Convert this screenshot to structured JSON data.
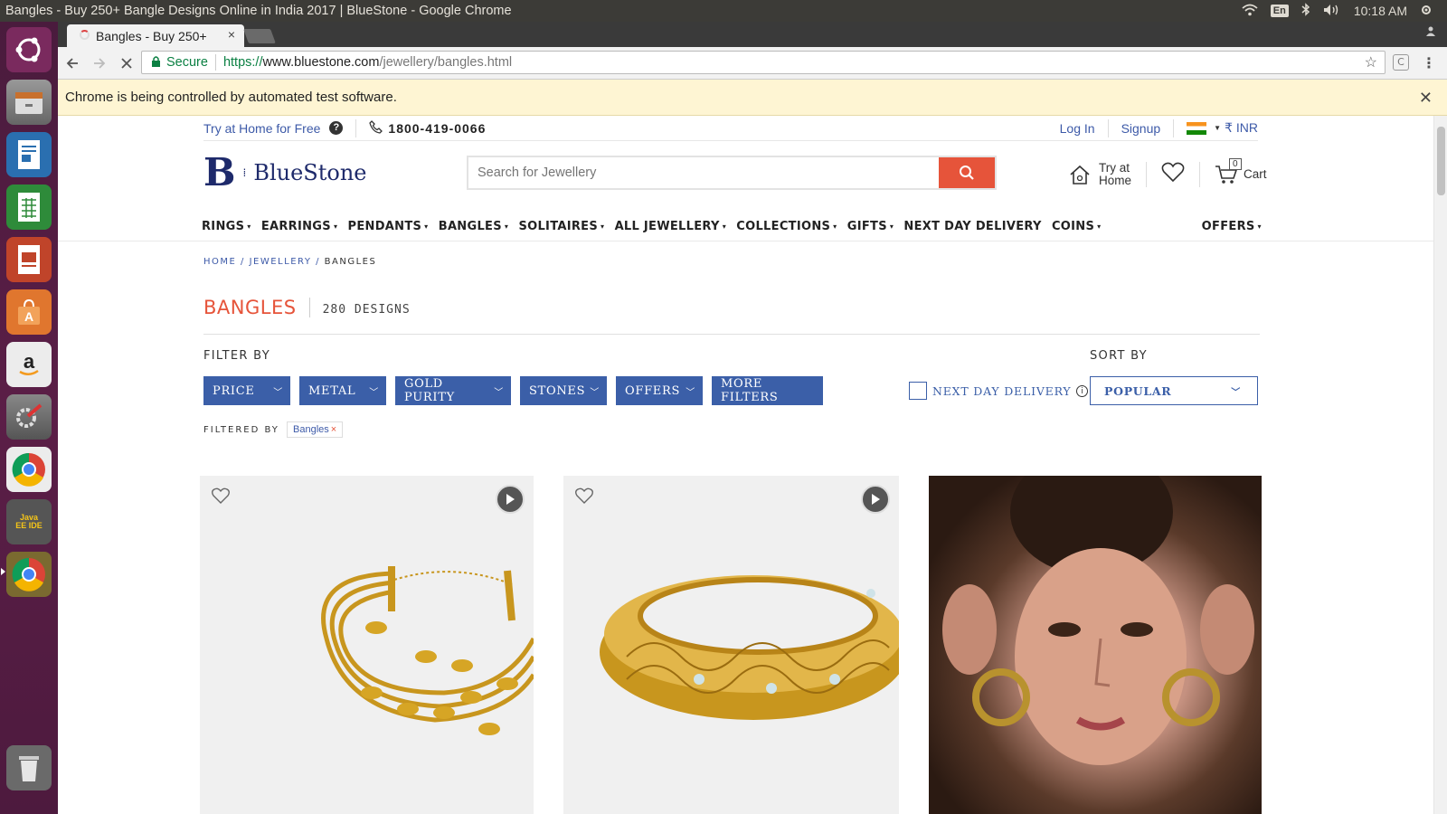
{
  "os": {
    "window_title": "Bangles - Buy 250+ Bangle Designs Online in India 2017 | BlueStone - Google Chrome",
    "keyboard": "En",
    "clock": "10:18 AM",
    "launcher_apps": [
      "ubuntu-dash",
      "files",
      "writer",
      "calc",
      "impress",
      "software-center",
      "amazon",
      "system-settings",
      "chrome",
      "java-ee-ide",
      "chrome-active",
      "trash"
    ],
    "java_label": "Java EE IDE"
  },
  "browser": {
    "tab_title": "Bangles - Buy 250+",
    "tab_close": "×",
    "secure_label": "Secure",
    "url_scheme": "https://",
    "url_host": "www.bluestone.com",
    "url_path": "/jewellery/bangles.html",
    "ext_label": "C",
    "infobar_text": "Chrome is being controlled by automated test software.",
    "infobar_close": "✕"
  },
  "header": {
    "try_home_free": "Try at Home for Free",
    "help": "?",
    "phone": "1800-419-0066",
    "login": "Log In",
    "signup": "Signup",
    "currency": "₹  INR",
    "logo_letter": "B",
    "logo_name": "BlueStone",
    "search_placeholder": "Search for Jewellery",
    "try_at_home_1": "Try at",
    "try_at_home_2": "Home",
    "cart_count": "0",
    "cart_label": "Cart"
  },
  "nav": {
    "items": [
      "RINGS",
      "EARRINGS",
      "PENDANTS",
      "BANGLES",
      "SOLITAIRES",
      "ALL JEWELLERY",
      "COLLECTIONS",
      "GIFTS",
      "NEXT DAY DELIVERY",
      "COINS",
      "OFFERS"
    ],
    "caret": "⌄"
  },
  "breadcrumb": {
    "home": "HOME",
    "sep": " / ",
    "jewellery": "JEWELLERY",
    "current": "BANGLES"
  },
  "listing": {
    "title": "BANGLES",
    "count": "280 DESIGNS",
    "filter_by": "FILTER BY",
    "filters": [
      "PRICE",
      "METAL",
      "GOLD PURITY",
      "STONES",
      "OFFERS",
      "MORE FILTERS"
    ],
    "next_day": "NEXT DAY DELIVERY",
    "info": "i",
    "sort_by": "SORT BY",
    "sort_value": "POPULAR",
    "filtered_by": "FILTERED BY",
    "chip": "Bangles",
    "chip_remove": "×"
  },
  "colors": {
    "brand_blue": "#3b5fa8",
    "accent_red": "#e6543a",
    "logo_navy": "#1e2a6b"
  }
}
